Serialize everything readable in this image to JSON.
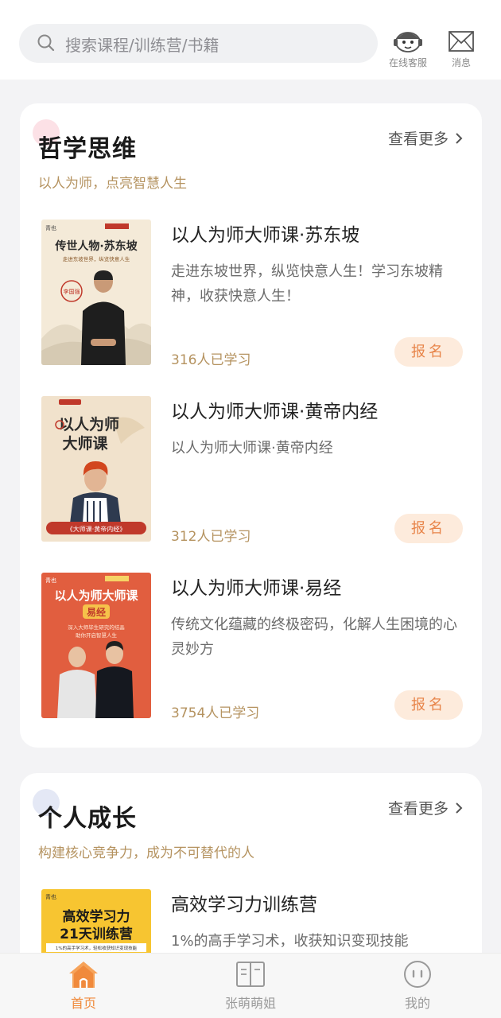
{
  "header": {
    "search_placeholder": "搜索课程/训练营/书籍",
    "service_label": "在线客服",
    "message_label": "消息"
  },
  "sections": [
    {
      "title": "哲学思维",
      "subtitle": "以人为师，点亮智慧人生",
      "more_label": "查看更多",
      "dot_color": "#fce1e6",
      "courses": [
        {
          "title": "以人为师大师课·苏东坡",
          "desc": "走进东坡世界，纵览快意人生！学习东坡精神，收获快意人生！",
          "count": "316人已学习",
          "enroll": "报名",
          "cover": {
            "big": "传世人物·苏东坡",
            "small": "走进东坡世界，纵览快意人生",
            "name": "李国强",
            "brand": "青也"
          }
        },
        {
          "title": "以人为师大师课·黄帝内经",
          "desc": "以人为师大师课·黄帝内经",
          "count": "312人已学习",
          "enroll": "报名",
          "cover": {
            "big1": "以人为师",
            "big2": "大师课",
            "foot": "《大师课·黄帝内经》"
          }
        },
        {
          "title": "以人为师大师课·易经",
          "desc": "传统文化蕴藏的终极密码，化解人生困境的心灵妙方",
          "count": "3754人已学习",
          "enroll": "报名",
          "cover": {
            "big": "以人为师大师课",
            "tag": "易经",
            "small1": "深入大师毕生研究的结晶",
            "small2": "助你开启智慧人生",
            "brand": "青也"
          }
        }
      ]
    },
    {
      "title": "个人成长",
      "subtitle": "构建核心竞争力，成为不可替代的人",
      "more_label": "查看更多",
      "dot_color": "#e4e8f5",
      "courses": [
        {
          "title": "高效学习力训练营",
          "desc": "1%的高手学习术，收获知识变现技能",
          "cover": {
            "big1": "高效学习力",
            "big2": "21天训练营",
            "small": "1%的高手学习术，轻松收获知识变现技能",
            "brand": "青也"
          }
        }
      ]
    }
  ],
  "tabbar": {
    "items": [
      {
        "label": "首页",
        "active": true
      },
      {
        "label": "张萌萌姐",
        "active": false
      },
      {
        "label": "我的",
        "active": false
      }
    ]
  },
  "colors": {
    "accent": "#f08a3c",
    "gold_text": "#b59360",
    "enroll_bg": "#fdebdc",
    "enroll_text": "#e8854a",
    "background": "#f3f3f5"
  }
}
